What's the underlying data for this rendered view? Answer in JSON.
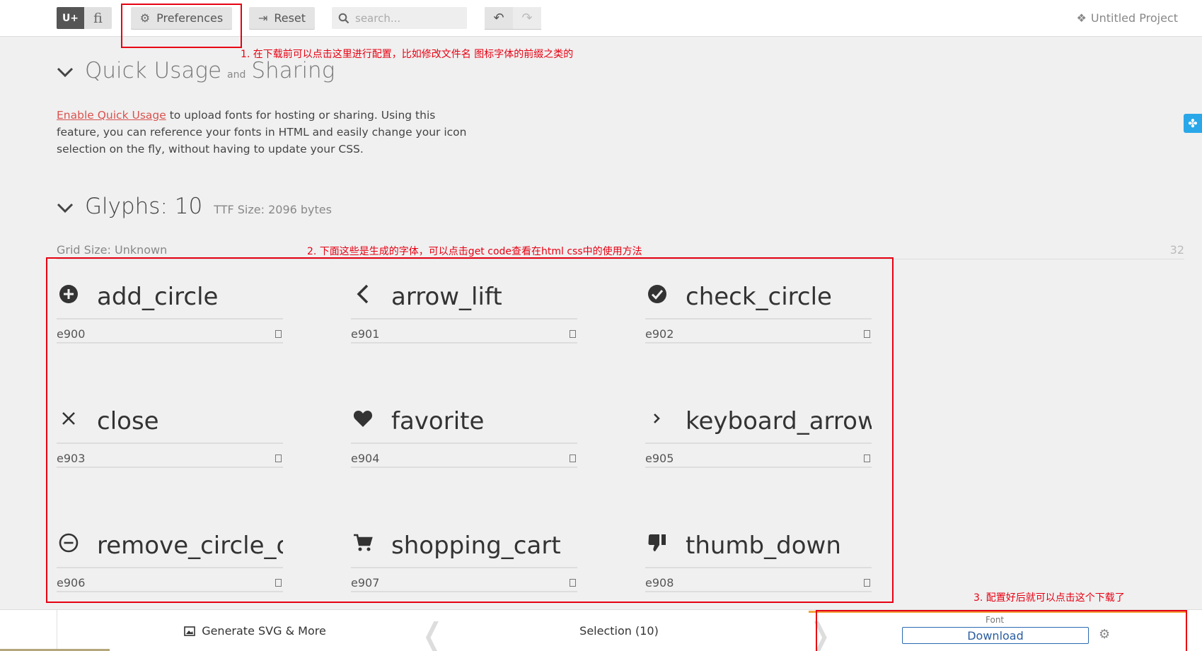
{
  "toolbar": {
    "mode_unicode": "U+",
    "mode_ligature": "fi",
    "preferences_label": "Preferences",
    "reset_label": "Reset",
    "search_placeholder": "search...",
    "project_name": "Untitled Project"
  },
  "annotations": {
    "note1": "1. 在下载前可以点击这里进行配置，比如修改文件名 图标字体的前缀之类的",
    "note2": "2. 下面这些是生成的字体，可以点击get code查看在html css中的使用方法",
    "note3": "3. 配置好后就可以点击这个下载了"
  },
  "quick_usage": {
    "title_1": "Quick Usage",
    "title_and": "and",
    "title_2": "Sharing",
    "link_text": "Enable Quick Usage",
    "desc_rest": " to upload fonts for hosting or sharing. Using this feature, you can reference your fonts in HTML and easily change your icon selection on the fly, without having to update your CSS."
  },
  "glyphs_section": {
    "title": "Glyphs: 10",
    "ttf_size": "TTF Size: 2096 bytes",
    "grid_size": "Grid Size: Unknown",
    "grid_number": "32"
  },
  "glyphs": [
    {
      "name": "add_circle",
      "code": "e900",
      "icon": "add-circle-icon"
    },
    {
      "name": "arrow_lift",
      "code": "e901",
      "icon": "arrow-left-icon"
    },
    {
      "name": "check_circle",
      "code": "e902",
      "icon": "check-circle-icon"
    },
    {
      "name": "close",
      "code": "e903",
      "icon": "close-icon"
    },
    {
      "name": "favorite",
      "code": "e904",
      "icon": "heart-icon"
    },
    {
      "name": "keyboard_arrow_",
      "code": "e905",
      "icon": "chevron-right-icon"
    },
    {
      "name": "remove_circle_ou",
      "code": "e906",
      "icon": "remove-circle-icon"
    },
    {
      "name": "shopping_cart",
      "code": "e907",
      "icon": "cart-icon"
    },
    {
      "name": "thumb_down",
      "code": "e908",
      "icon": "thumb-down-icon"
    }
  ],
  "bottom_bar": {
    "generate_label": "Generate SVG & More",
    "selection_label": "Selection (10)",
    "font_label": "Font",
    "download_label": "Download"
  },
  "colors": {
    "annotation_red": "#e60012",
    "link_red": "#d9534f",
    "download_blue": "#2a5d9e",
    "accent_orange": "#f3a23b"
  }
}
